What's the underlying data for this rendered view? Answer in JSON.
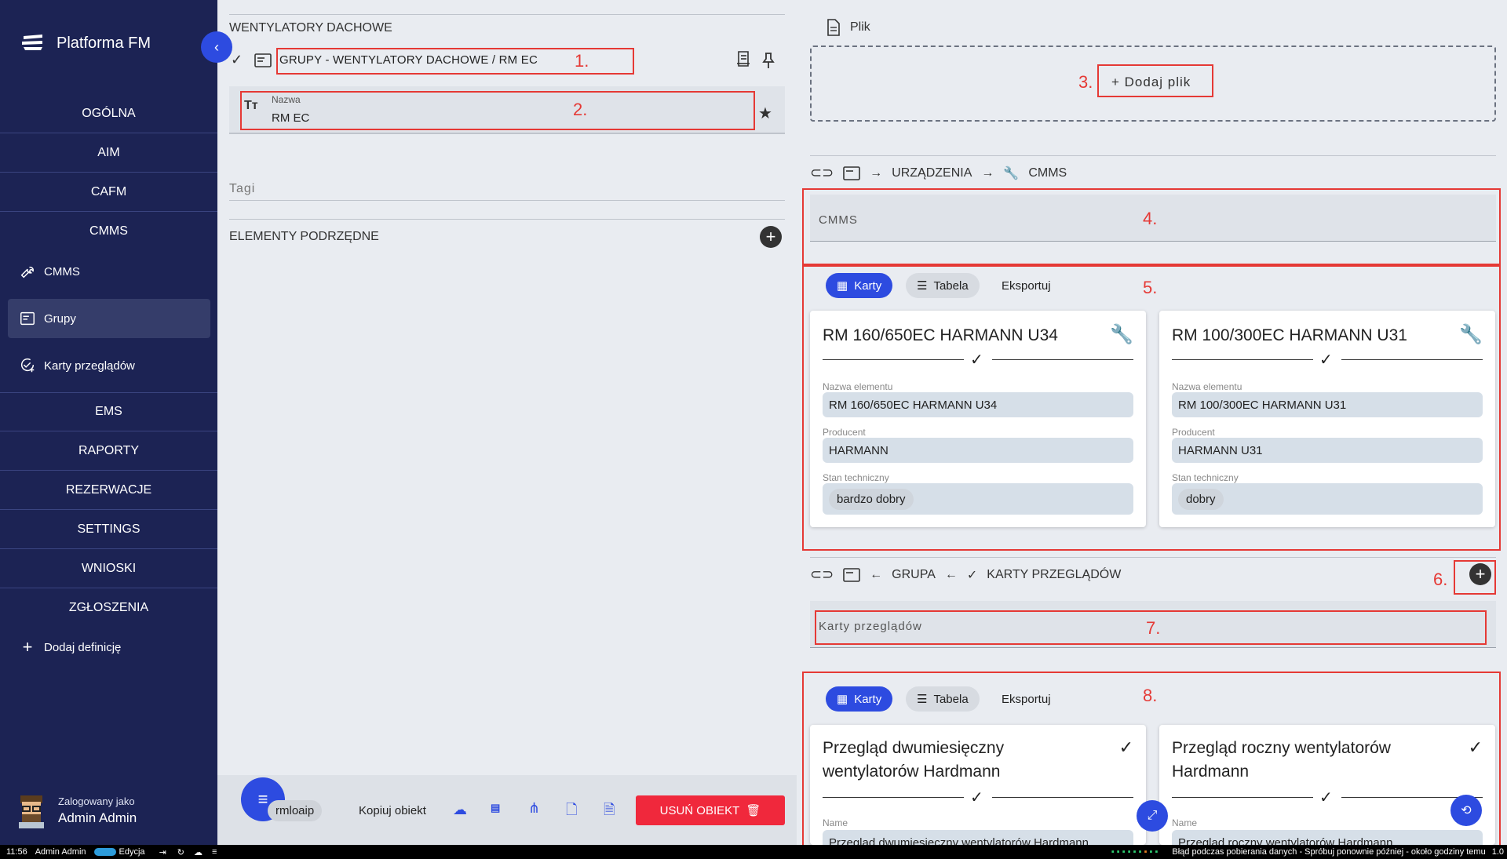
{
  "sidebar": {
    "brand": "Platforma FM",
    "sections": [
      "OGÓLNA",
      "AIM",
      "CAFM",
      "CMMS"
    ],
    "cmms_items": [
      {
        "label": "CMMS",
        "icon": "wrench-icon"
      },
      {
        "label": "Grupy",
        "icon": "card-icon"
      },
      {
        "label": "Karty przeglądów",
        "icon": "check-plus-icon"
      }
    ],
    "sections2": [
      "EMS",
      "RAPORTY",
      "REZERWACJE",
      "SETTINGS",
      "WNIOSKI",
      "ZGŁOSZENIA"
    ],
    "add_definition": "Dodaj definicję",
    "user_label": "Zalogowany jako",
    "user_name": "Admin Admin"
  },
  "left": {
    "header": "WENTYLATORY DACHOWE",
    "group_path": "GRUPY - WENTYLATORY DACHOWE / RM EC",
    "name_label": "Nazwa",
    "name_value": "RM EC",
    "tags_label": "Tagi",
    "children_header": "ELEMENTY PODRZĘDNE"
  },
  "annotations": [
    "1.",
    "2.",
    "3.",
    "4.",
    "5.",
    "6.",
    "7.",
    "8."
  ],
  "file": {
    "label": "Plik",
    "add_label": "Dodaj plik"
  },
  "rel1": {
    "path": [
      "URZĄDZENIA",
      "CMMS"
    ],
    "search_placeholder": "CMMS",
    "tabs": [
      "Karty",
      "Tabela",
      "Eksportuj"
    ],
    "cards": [
      {
        "title": "RM 160/650EC HARMANN U34",
        "f1_label": "Nazwa elementu",
        "f1": "RM 160/650EC HARMANN U34",
        "f2_label": "Producent",
        "f2": "HARMANN",
        "f3_label": "Stan techniczny",
        "f3": "bardzo dobry"
      },
      {
        "title": "RM 100/300EC HARMANN U31",
        "f1_label": "Nazwa elementu",
        "f1": "RM 100/300EC HARMANN U31",
        "f2_label": "Producent",
        "f2": "HARMANN U31",
        "f3_label": "Stan techniczny",
        "f3": "dobry"
      }
    ]
  },
  "rel2": {
    "path": [
      "GRUPA",
      "KARTY PRZEGLĄDÓW"
    ],
    "search_placeholder": "Karty przeglądów",
    "tabs": [
      "Karty",
      "Tabela",
      "Eksportuj"
    ],
    "cards": [
      {
        "title1": "Przegląd dwumiesięczny",
        "title2": "wentylatorów Hardmann",
        "f1_label": "Name",
        "f1": "Przegląd dwumiesięczny wentylatorów Hardmann"
      },
      {
        "title1": "Przegląd roczny wentylatorów",
        "title2": "Hardmann",
        "f1_label": "Name",
        "f1": "Przegląd roczny wentylatorów Hardmann"
      }
    ]
  },
  "bottombar": {
    "chip": "rmloaip",
    "copy": "Kopiuj obiekt",
    "delete": "USUŃ OBIEKT"
  },
  "statusbar": {
    "time": "11:56",
    "user": "Admin Admin",
    "mode": "Edycja",
    "error": "Błąd podczas pobierania danych - Spróbuj ponownie później - około godziny temu",
    "version": "1.0"
  },
  "colors": {
    "sidebar": "#1c2354",
    "accent": "#2d4be0",
    "danger": "#f0283c",
    "annotation": "#e53935"
  }
}
